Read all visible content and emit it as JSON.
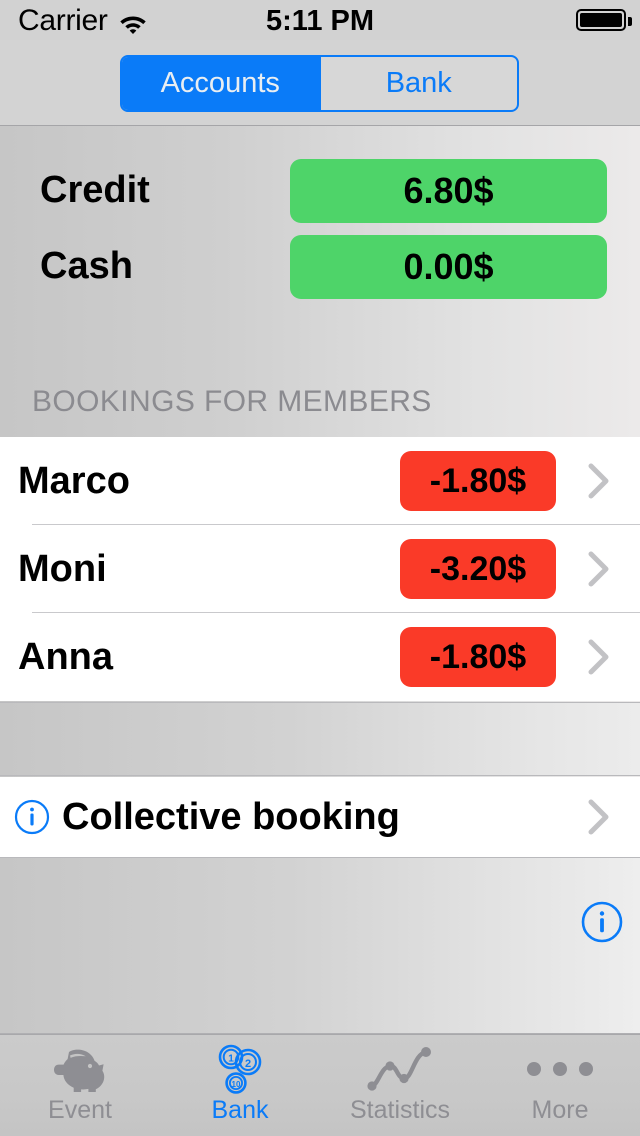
{
  "status_bar": {
    "carrier": "Carrier",
    "wifi_icon": "wifi-icon",
    "time": "5:11 PM",
    "battery_icon": "battery-full-icon"
  },
  "segmented_control": {
    "segments": [
      {
        "label": "Accounts",
        "selected": true
      },
      {
        "label": "Bank",
        "selected": false
      }
    ],
    "tint_color": "#0a7bf8"
  },
  "totals": [
    {
      "label": "Credit",
      "value": "6.80$",
      "color": "#4ed469"
    },
    {
      "label": "Cash",
      "value": "0.00$",
      "color": "#4ed469"
    }
  ],
  "section_header": "BOOKINGS FOR MEMBERS",
  "members": [
    {
      "name": "Marco",
      "amount": "-1.80$",
      "color": "#fa3a28",
      "chevron": "chevron-right-icon"
    },
    {
      "name": "Moni",
      "amount": "-3.20$",
      "color": "#fa3a28",
      "chevron": "chevron-right-icon"
    },
    {
      "name": "Anna",
      "amount": "-1.80$",
      "color": "#fa3a28",
      "chevron": "chevron-right-icon"
    }
  ],
  "collective_booking": {
    "info_icon": "info-circle-icon",
    "label": "Collective booking",
    "chevron": "chevron-right-icon"
  },
  "footer_info_button": {
    "icon": "info-circle-icon"
  },
  "tab_bar": {
    "tabs": [
      {
        "label": "Event",
        "icon": "piggy-bank-icon",
        "selected": false
      },
      {
        "label": "Bank",
        "icon": "coins-icon",
        "selected": true
      },
      {
        "label": "Statistics",
        "icon": "line-chart-icon",
        "selected": false
      },
      {
        "label": "More",
        "icon": "ellipsis-icon",
        "selected": false
      }
    ],
    "selected_color": "#0a7bf8",
    "unselected_color": "#8e8e93"
  },
  "coin_labels": [
    "1",
    "2",
    "10"
  ]
}
